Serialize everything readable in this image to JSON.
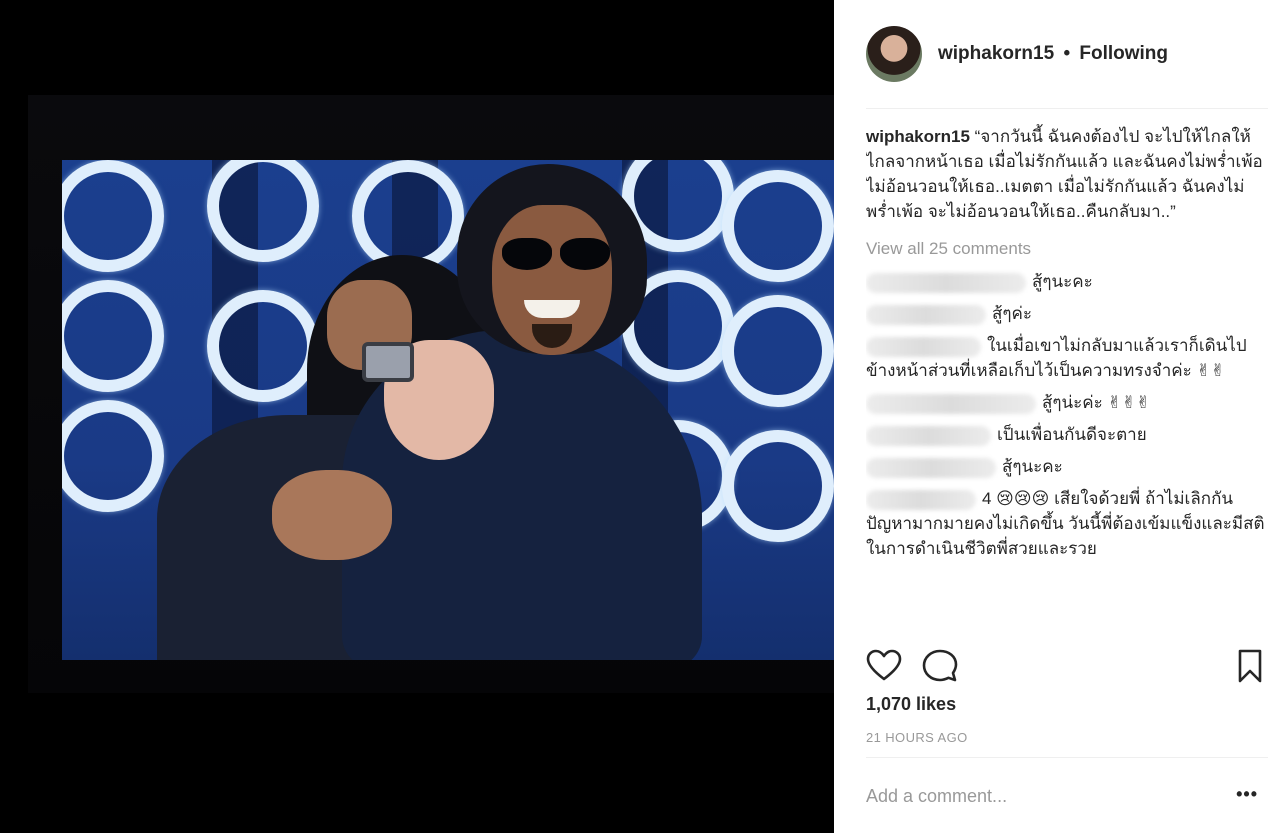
{
  "post": {
    "username": "wiphakorn15",
    "separator": "•",
    "follow_status": "Following",
    "caption": "“จากวันนี้ ฉันคงต้องไป จะไปให้ไกลให้ไกลจากหน้าเธอ เมื่อไม่รักกันแล้ว และฉันคงไม่พร่ำเพ้อ ไม่อ้อนวอนให้เธอ..เมตตา เมื่อไม่รักกันแล้ว ฉันคงไม่พร่ำเพ้อ จะไม่อ้อนวอนให้เธอ..คืนกลับมา..”",
    "view_all": "View all 25 comments",
    "comments": [
      {
        "text": "สู้ๆนะคะ"
      },
      {
        "text": "สู้ๆค่ะ"
      },
      {
        "text": "ในเมื่อเขาไม่กลับมาแล้วเราก็เดินไปข้างหน้าส่วนที่เหลือเก็บไว้เป็นความทรงจำค่ะ ✌✌"
      },
      {
        "text": "สู้ๆน่ะค่ะ ✌✌✌"
      },
      {
        "text": "เป็นเพื่อนกันดีจะตาย"
      },
      {
        "text": "สู้ๆนะคะ"
      },
      {
        "text": "4 😢😢😢 เสียใจด้วยพี่ ถ้าไม่เลิกกันปัญหามากมายคงไม่เกิดขึ้น วันนี้พี่ต้องเข้มแข็งและมีสติในการดำเนินชีวิตพี่สวยและรวย"
      }
    ],
    "likes": "1,070 likes",
    "time": "21 HOURS AGO",
    "add_comment_placeholder": "Add a comment...",
    "more": "•••"
  },
  "icons": {
    "like": "heart-icon",
    "comment": "comment-icon",
    "save": "bookmark-icon"
  }
}
